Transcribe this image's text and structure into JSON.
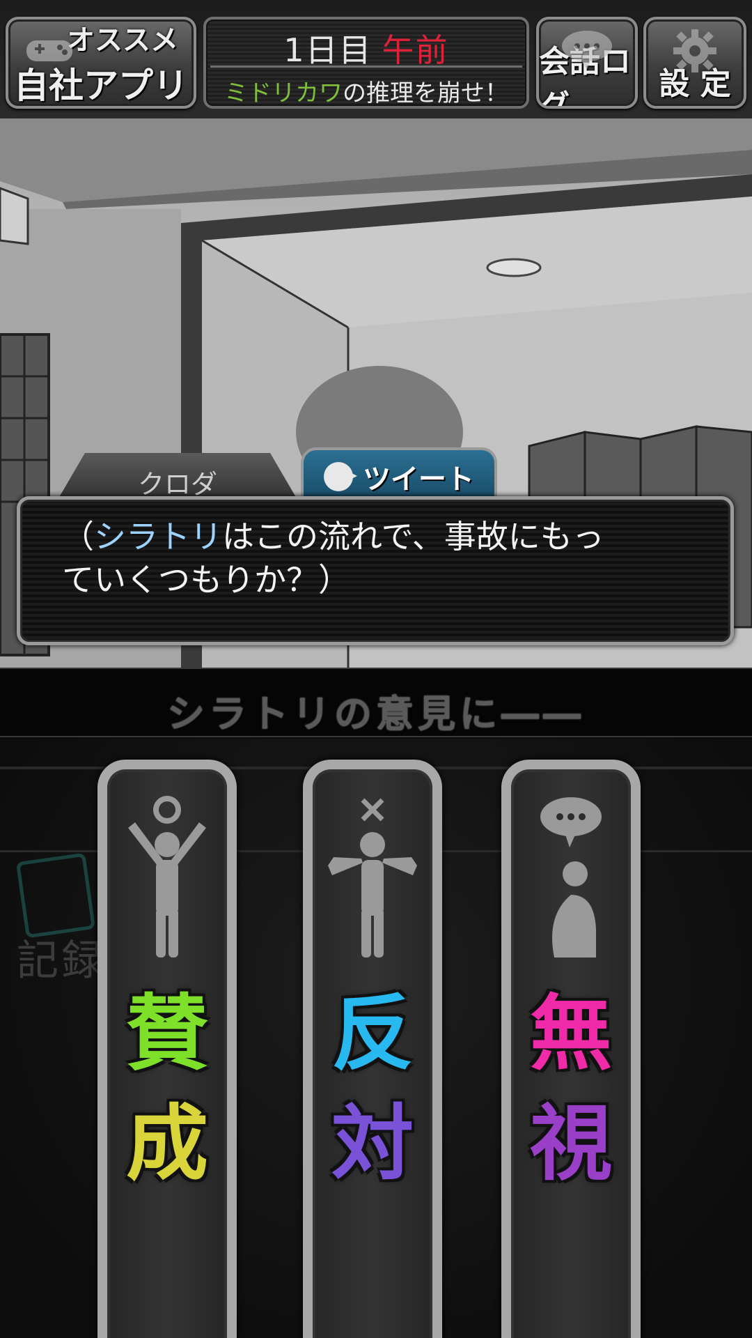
{
  "topbar": {
    "app_button": {
      "line1": "オススメ",
      "line2": "自社アプリ"
    },
    "day": "1日目",
    "phase": "午前",
    "goal": {
      "name": "ミドリカワ",
      "rest": "の推理を崩せ！"
    },
    "log_button": "会話ログ",
    "settings_button": "設 定"
  },
  "dialog": {
    "speaker": "クロダ",
    "tweet_button": "ツイート",
    "line1_open": "（",
    "line1_name": "シラトリ",
    "line1_rest": "はこの流れで、事故にもっ",
    "line2": "ていくつもりか？）"
  },
  "prompt": "シラトリの意見に――",
  "background_label": "記録",
  "choices": [
    {
      "k1": "賛",
      "k2": "成",
      "color1": "#7fe02a",
      "color2": "#d8d43a",
      "icon": "arms-up-circle-icon"
    },
    {
      "k1": "反",
      "k2": "対",
      "color1": "#27b9f0",
      "color2": "#7a52d8",
      "icon": "shrug-cross-icon"
    },
    {
      "k1": "無",
      "k2": "視",
      "color1": "#f02aa8",
      "color2": "#9a3fc8",
      "icon": "sitting-speech-icon"
    }
  ],
  "colors": {
    "phase": "#e0213a",
    "goal_name": "#7fbf3b",
    "dialog_highlight": "#9fd3ff",
    "tweet_blue": "#2c6f93"
  }
}
